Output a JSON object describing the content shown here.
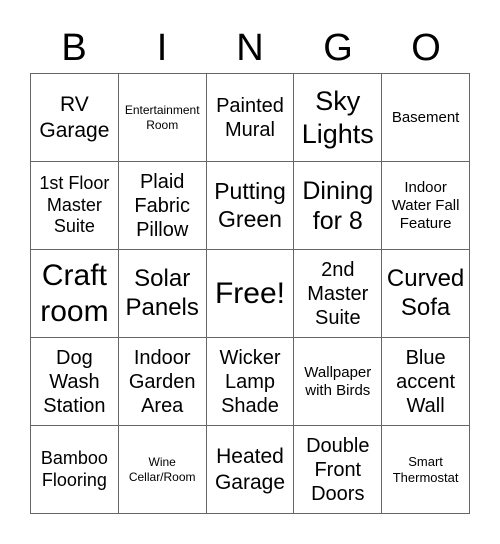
{
  "header": [
    "B",
    "I",
    "N",
    "G",
    "O"
  ],
  "cells": [
    {
      "text": "RV Garage",
      "size": 21
    },
    {
      "text": "Entertainment Room",
      "size": 12
    },
    {
      "text": "Painted Mural",
      "size": 20
    },
    {
      "text": "Sky Lights",
      "size": 27
    },
    {
      "text": "Basement",
      "size": 15
    },
    {
      "text": "1st Floor Master Suite",
      "size": 18
    },
    {
      "text": "Plaid Fabric Pillow",
      "size": 20
    },
    {
      "text": "Putting Green",
      "size": 23
    },
    {
      "text": "Dining for 8",
      "size": 25
    },
    {
      "text": "Indoor Water Fall Feature",
      "size": 15
    },
    {
      "text": "Craft room",
      "size": 30
    },
    {
      "text": "Solar Panels",
      "size": 24
    },
    {
      "text": "Free!",
      "size": 30
    },
    {
      "text": "2nd Master Suite",
      "size": 20
    },
    {
      "text": "Curved Sofa",
      "size": 24
    },
    {
      "text": "Dog Wash Station",
      "size": 20
    },
    {
      "text": "Indoor Garden Area",
      "size": 20
    },
    {
      "text": "Wicker Lamp Shade",
      "size": 20
    },
    {
      "text": "Wallpaper with Birds",
      "size": 15
    },
    {
      "text": "Blue accent Wall",
      "size": 20
    },
    {
      "text": "Bamboo Flooring",
      "size": 18
    },
    {
      "text": "Wine Cellar/Room",
      "size": 12
    },
    {
      "text": "Heated Garage",
      "size": 21
    },
    {
      "text": "Double Front Doors",
      "size": 20
    },
    {
      "text": "Smart Thermostat",
      "size": 13
    }
  ]
}
